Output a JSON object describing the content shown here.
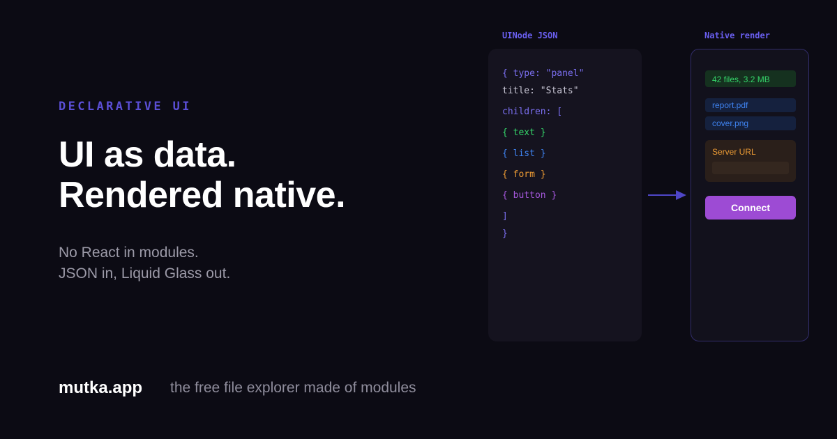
{
  "hero": {
    "eyebrow": "DECLARATIVE UI",
    "headline": [
      "UI as data.",
      "Rendered native."
    ],
    "subtitle": [
      "No React in modules.",
      "JSON in, Liquid Glass out."
    ]
  },
  "footer": {
    "brand": "mutka.app",
    "tagline": "the free file explorer made of modules"
  },
  "json_panel": {
    "label": "UINode JSON",
    "lines": [
      {
        "text": "{ type: \"panel\"",
        "color": "#7b6ff0"
      },
      {
        "text": "title: \"Stats\"",
        "color": "#c8c6d4"
      },
      {
        "text": "children: [",
        "color": "#7b6ff0"
      },
      {
        "text": "{ text }",
        "color": "#35d56a"
      },
      {
        "text": "{ list }",
        "color": "#3f83f0"
      },
      {
        "text": "{ form }",
        "color": "#eb9a34"
      },
      {
        "text": "{ button }",
        "color": "#a457db"
      },
      {
        "text": "]",
        "color": "#7b6ff0"
      },
      {
        "text": "}",
        "color": "#7b6ff0"
      }
    ]
  },
  "native_panel": {
    "label": "Native render",
    "stat_text": "42 files, 3.2 MB",
    "files": [
      "report.pdf",
      "cover.png"
    ],
    "form_label": "Server URL",
    "form_value": "",
    "button_label": "Connect"
  },
  "colors": {
    "background": "#0c0b14",
    "accent": "#6a5ff0",
    "green": "#35d56a",
    "blue": "#3f83f0",
    "orange": "#eb9a34",
    "purple": "#9d4bd4"
  },
  "icons": {
    "arrow": "arrow-right-icon"
  }
}
